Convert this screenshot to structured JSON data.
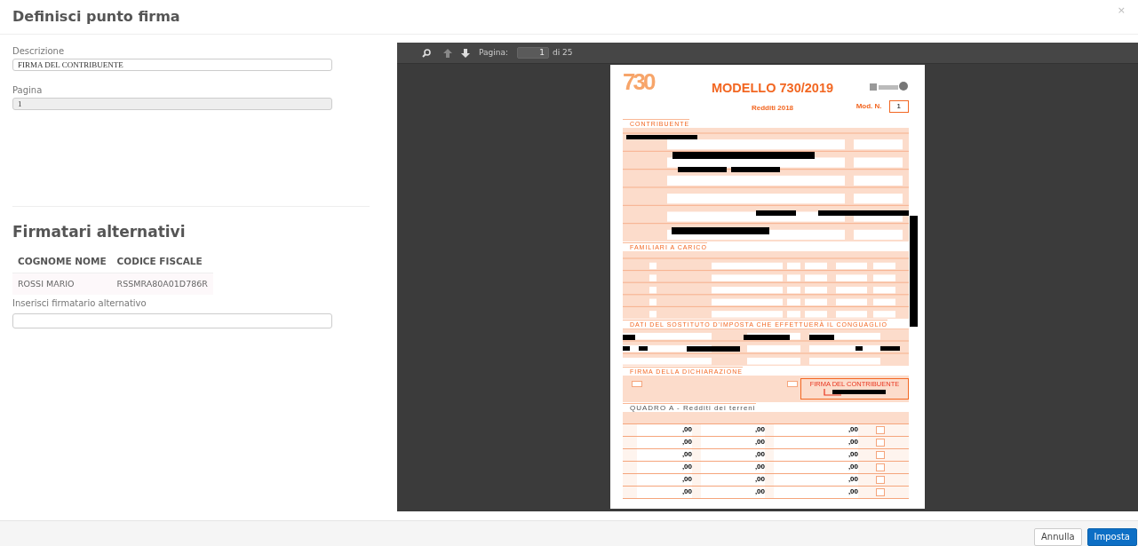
{
  "dialog": {
    "title": "Definisci punto firma",
    "close": "×"
  },
  "form": {
    "description_label": "Descrizione",
    "description_value": "FIRMA DEL CONTRIBUENTE",
    "page_label": "Pagina",
    "page_value": "1"
  },
  "signers": {
    "title": "Firmatari alternativi",
    "columns": [
      "COGNOME NOME",
      "CODICE FISCALE"
    ],
    "rows": [
      [
        "ROSSI MARIO",
        "RSSMRA80A01D786R"
      ]
    ],
    "add_label": "Inserisci firmatario alternativo"
  },
  "viewer": {
    "page_label": "Pagina:",
    "page_value": "1",
    "page_total": "di 25",
    "document": {
      "logo": "730",
      "title": "MODELLO 730/2019",
      "subtitle": "Redditi 2018",
      "mod_label": "Mod. N.",
      "mod_number": "1",
      "sections": [
        {
          "kind": "contributor",
          "title": "CONTRIBUENTE"
        },
        {
          "kind": "dependents",
          "title": "FAMILIARI A CARICO"
        },
        {
          "kind": "withholding",
          "title": "DATI DEL SOSTITUTO D'IMPOSTA CHE EFFETTUERÀ IL CONGUAGLIO"
        },
        {
          "kind": "signature",
          "title": "FIRMA DELLA DICHIARAZIONE",
          "box_title": "FIRMA DEL CONTRIBUENTE"
        },
        {
          "kind": "land",
          "title": "QUADRO  A  - Redditi dei terreni",
          "rows": [
            [
              ",00",
              ",00",
              ",00"
            ],
            [
              ",00",
              ",00",
              ",00"
            ],
            [
              ",00",
              ",00",
              ",00"
            ],
            [
              ",00",
              ",00",
              ",00"
            ],
            [
              ",00",
              ",00",
              ",00"
            ],
            [
              ",00",
              ",00",
              ",00"
            ]
          ]
        }
      ]
    }
  },
  "buttons": [
    {
      "label": "Annulla",
      "primary": false
    },
    {
      "label": "Imposta",
      "primary": true
    }
  ]
}
